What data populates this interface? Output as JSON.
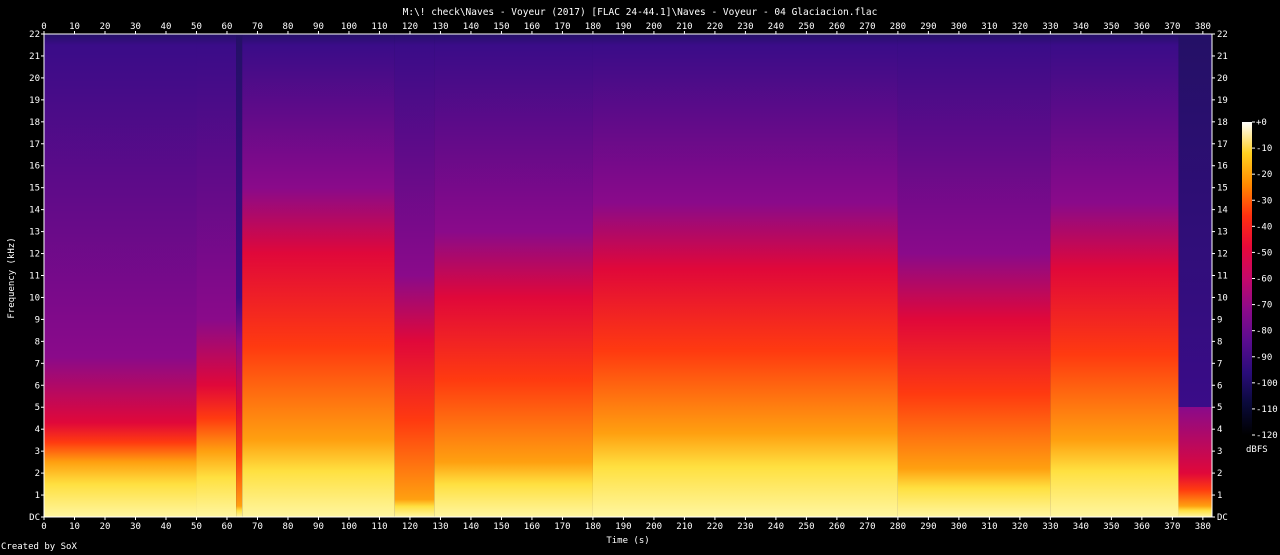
{
  "chart_data": {
    "type": "heatmap",
    "title": "M:\\! check\\Naves - Voyeur (2017) [FLAC 24-44.1]\\Naves - Voyeur - 04 Glaciacion.flac",
    "xlabel": "Time (s)",
    "ylabel": "Frequency (kHz)",
    "xlim": [
      0,
      383
    ],
    "ylim": [
      0,
      22
    ],
    "x_ticks": [
      "0",
      "10",
      "20",
      "30",
      "40",
      "50",
      "60",
      "70",
      "80",
      "90",
      "100",
      "110",
      "120",
      "130",
      "140",
      "150",
      "160",
      "170",
      "180",
      "190",
      "200",
      "210",
      "220",
      "230",
      "240",
      "250",
      "260",
      "270",
      "280",
      "290",
      "300",
      "310",
      "320",
      "330",
      "340",
      "350",
      "360",
      "370",
      "380"
    ],
    "y_ticks": [
      "DC",
      "1",
      "2",
      "3",
      "4",
      "5",
      "6",
      "7",
      "8",
      "9",
      "10",
      "11",
      "12",
      "13",
      "14",
      "15",
      "16",
      "17",
      "18",
      "19",
      "20",
      "21",
      "22"
    ],
    "colorbar": {
      "label": "dBFS",
      "ticks": [
        "+0",
        "-10",
        "-20",
        "-30",
        "-40",
        "-50",
        "-60",
        "-70",
        "-80",
        "-90",
        "-100",
        "-110",
        "-120"
      ],
      "range": [
        -120,
        0
      ]
    },
    "segments": [
      {
        "t0": 0,
        "t1": 50,
        "body_khz": 4.3,
        "bright_khz": 2.5,
        "tail_khz": 21.5
      },
      {
        "t0": 50,
        "t1": 63,
        "body_khz": 6,
        "bright_khz": 3,
        "tail_khz": 21.5
      },
      {
        "t0": 63,
        "t1": 65,
        "body_khz": 5,
        "bright_khz": 0.5,
        "tail_khz": 10
      },
      {
        "t0": 65,
        "t1": 115,
        "body_khz": 12,
        "bright_khz": 3.5,
        "tail_khz": 21.5
      },
      {
        "t0": 115,
        "t1": 128,
        "body_khz": 8,
        "bright_khz": 0.8,
        "tail_khz": 21.5
      },
      {
        "t0": 128,
        "t1": 180,
        "body_khz": 10,
        "bright_khz": 2.5,
        "tail_khz": 21.5
      },
      {
        "t0": 180,
        "t1": 280,
        "body_khz": 11.3,
        "bright_khz": 3.8,
        "tail_khz": 21.5
      },
      {
        "t0": 280,
        "t1": 330,
        "body_khz": 9,
        "bright_khz": 2.2,
        "tail_khz": 21.5
      },
      {
        "t0": 330,
        "t1": 372,
        "body_khz": 11.3,
        "bright_khz": 3.5,
        "tail_khz": 21.5
      },
      {
        "t0": 372,
        "t1": 383,
        "body_khz": 2,
        "bright_khz": 0.5,
        "tail_khz": 4
      }
    ]
  },
  "credit": "Created by SoX"
}
